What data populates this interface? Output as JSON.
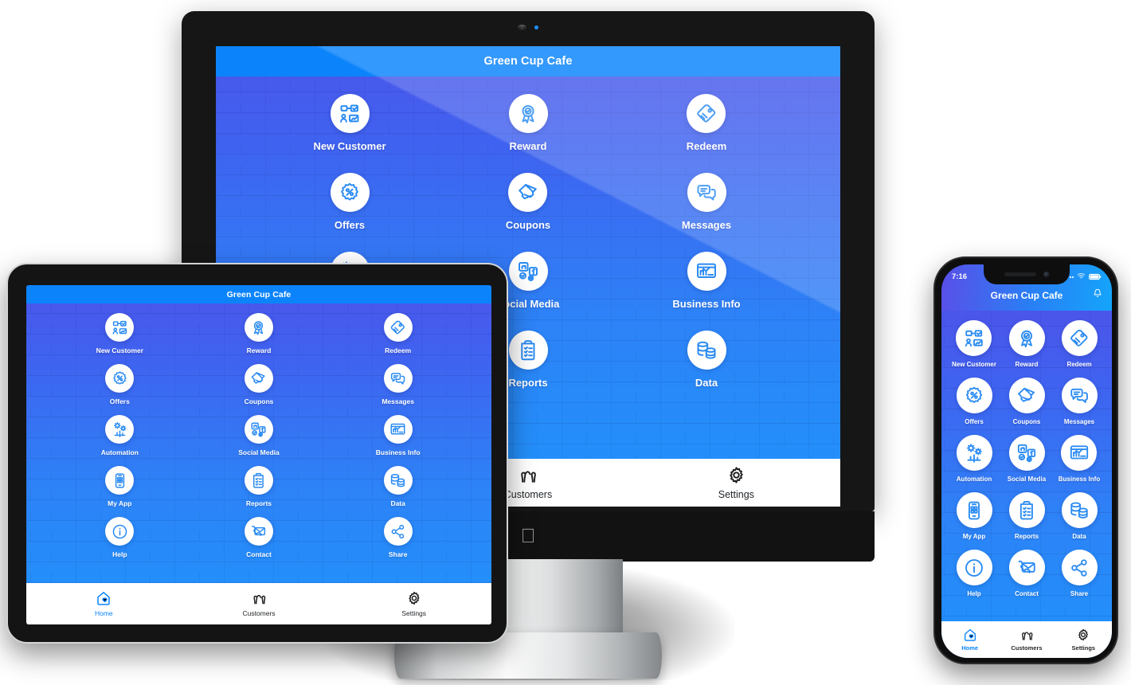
{
  "app": {
    "title": "Green Cup Cafe",
    "accent_color": "#0b84fb",
    "gradient_top": "#4b55ea",
    "gradient_bottom": "#1f93fb",
    "icon_stroke_color": "#2a8bf2"
  },
  "menu": [
    {
      "label": "New Customer",
      "icon": "new-customer-icon"
    },
    {
      "label": "Reward",
      "icon": "reward-badge-icon"
    },
    {
      "label": "Redeem",
      "icon": "redeem-tag-icon"
    },
    {
      "label": "Offers",
      "icon": "offers-percent-icon"
    },
    {
      "label": "Coupons",
      "icon": "coupons-ticket-icon"
    },
    {
      "label": "Messages",
      "icon": "messages-chat-icon"
    },
    {
      "label": "Automation",
      "icon": "automation-gear-chart-icon"
    },
    {
      "label": "Social Media",
      "icon": "social-media-icon"
    },
    {
      "label": "Business Info",
      "icon": "business-info-chart-icon"
    },
    {
      "label": "My App",
      "icon": "my-app-phone-icon"
    },
    {
      "label": "Reports",
      "icon": "reports-clipboard-icon"
    },
    {
      "label": "Data",
      "icon": "data-database-icon"
    },
    {
      "label": "Help",
      "icon": "help-info-icon"
    },
    {
      "label": "Contact",
      "icon": "contact-envelope-phone-icon"
    },
    {
      "label": "Share",
      "icon": "share-nodes-icon"
    }
  ],
  "tabs": [
    {
      "label": "Home",
      "icon": "home-heart-icon",
      "active": true
    },
    {
      "label": "Customers",
      "icon": "customers-people-icon",
      "active": false
    },
    {
      "label": "Settings",
      "icon": "settings-gear-icon",
      "active": false
    }
  ],
  "desktop": {
    "device": "imac",
    "brand_logo": "",
    "camera": "webcam-icon",
    "camera_led": "camera-led-indicator",
    "visible_tabs": [
      "Customers",
      "Settings"
    ],
    "visible_menu_count": 12
  },
  "tablet": {
    "device": "ipad",
    "visible_menu_count": 15
  },
  "phone": {
    "device": "iphone",
    "status_time": "7:16",
    "signal_icon": "signal-dots-icon",
    "wifi_icon": "wifi-icon",
    "battery_icon": "battery-full-icon",
    "notification_icon": "bell-icon",
    "visible_menu_count": 15
  }
}
